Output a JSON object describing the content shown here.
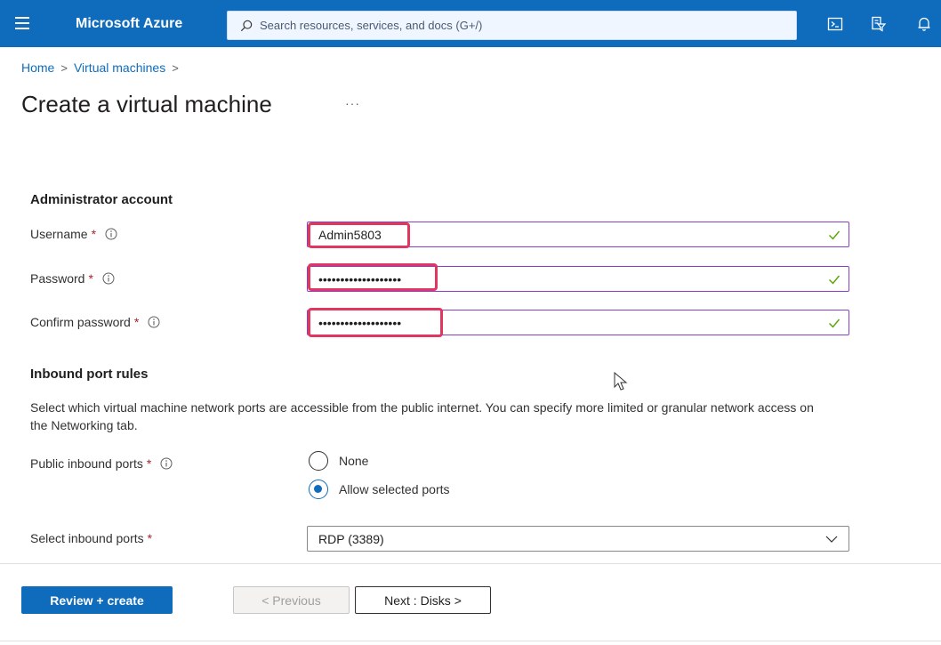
{
  "topbar": {
    "brand": "Microsoft Azure",
    "search_placeholder": "Search resources, services, and docs (G+/)",
    "icons": [
      "menu-icon",
      "search-icon",
      "cloud-shell-icon",
      "directory-filter-icon",
      "notifications-icon"
    ],
    "bg_color": "#0f6cbd"
  },
  "breadcrumb": {
    "items": [
      {
        "label": "Home"
      },
      {
        "label": "Virtual machines"
      }
    ],
    "separator": ">"
  },
  "page": {
    "title": "Create a virtual machine",
    "more_label": "···"
  },
  "admin_account": {
    "title": "Administrator account",
    "username": {
      "label": "Username",
      "required_mark": "*",
      "value": "Admin5803"
    },
    "password": {
      "label": "Password",
      "required_mark": "*",
      "value": "•••••••••••••••••••"
    },
    "confirm_password": {
      "label": "Confirm password",
      "required_mark": "*",
      "value": "•••••••••••••••••••"
    }
  },
  "inbound_rules": {
    "title": "Inbound port rules",
    "description": "Select which virtual machine network ports are accessible from the public internet. You can specify more limited or granular network access on the Networking tab.",
    "public_ports": {
      "label": "Public inbound ports",
      "required_mark": "*",
      "options": [
        {
          "label": "None",
          "selected": false
        },
        {
          "label": "Allow selected ports",
          "selected": true
        }
      ]
    },
    "select_ports": {
      "label": "Select inbound ports",
      "required_mark": "*",
      "value": "RDP (3389)"
    }
  },
  "footer": {
    "review_create": "Review + create",
    "previous": "< Previous",
    "next": "Next : Disks >"
  },
  "colors": {
    "accent": "#0f6cbd",
    "field_border": "#8a3fc8",
    "highlight": "#e0365f",
    "valid_check": "#57a300",
    "required": "#a4262c"
  }
}
